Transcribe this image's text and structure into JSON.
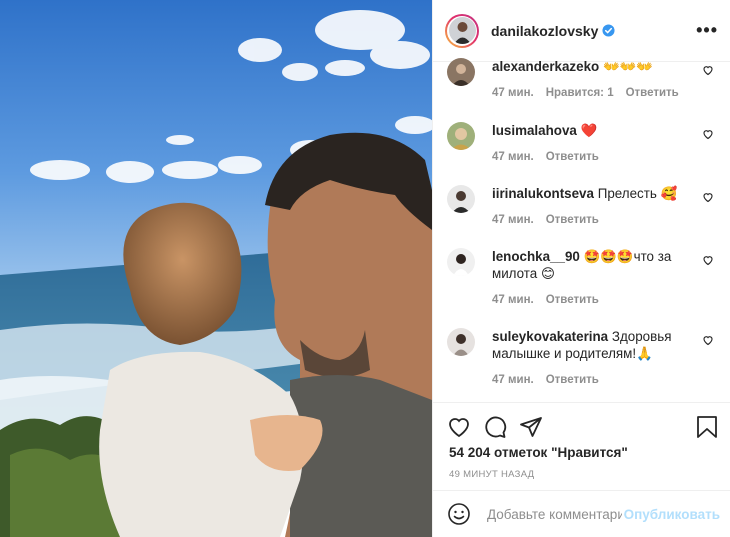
{
  "post": {
    "author": "danilakozlovsky",
    "more_label": "•••"
  },
  "comments": [
    {
      "user": "alexanderkazeko",
      "text": "👐👐👐",
      "time": "47 мин.",
      "likes": "Нравится: 1",
      "reply": "Ответить"
    },
    {
      "user": "lusimalahova",
      "text": "❤️",
      "time": "47 мин.",
      "likes": "",
      "reply": "Ответить"
    },
    {
      "user": "iirinalukontseva",
      "text": "Прелесть 🥰",
      "time": "47 мин.",
      "likes": "",
      "reply": "Ответить"
    },
    {
      "user": "lenochka__90",
      "text": "🤩🤩🤩что за милота 😊",
      "time": "47 мин.",
      "likes": "",
      "reply": "Ответить"
    },
    {
      "user": "suleykovakaterina",
      "text": "Здоровья малышке и родителям!🙏",
      "time": "47 мин.",
      "likes": "",
      "reply": "Ответить"
    }
  ],
  "actions": {
    "like_icon": "heart-outline-icon",
    "comment_icon": "comment-bubble-icon",
    "share_icon": "paper-plane-icon",
    "save_icon": "bookmark-icon"
  },
  "likes_text": "54 204 отметок \"Нравится\"",
  "time_ago": "49 МИНУТ НАЗАД",
  "add_comment": {
    "placeholder": "Добавьте комментарий...",
    "publish_label": "Опубликовать",
    "emoji_icon": "smiley-icon"
  },
  "colors": {
    "accent": "#0095f6",
    "publish_disabled": "#b2dffc",
    "muted": "#8e8e8e",
    "border": "#efefef"
  }
}
